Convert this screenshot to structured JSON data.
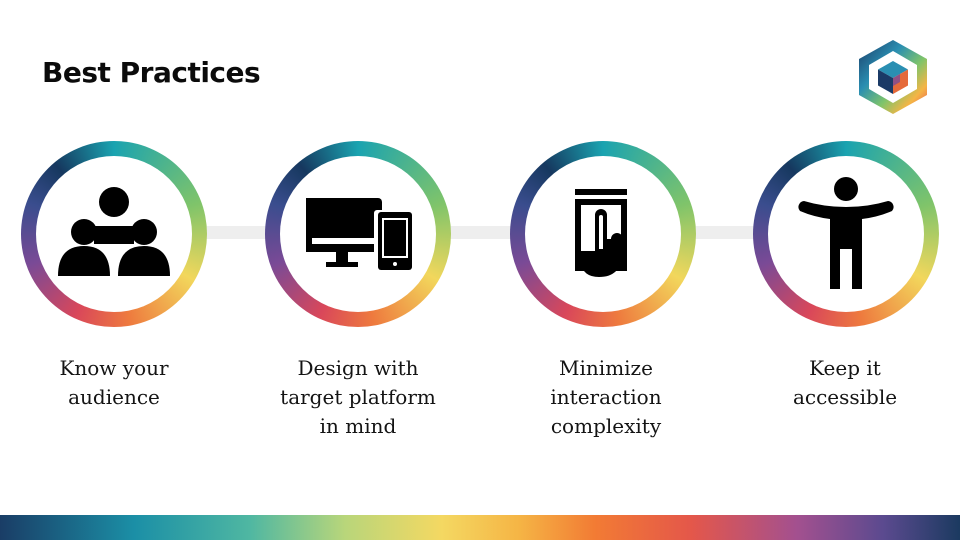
{
  "slide": {
    "title": "Best Practices"
  },
  "items": [
    {
      "lines": [
        "Know your",
        "audience"
      ],
      "icon": "audience-group-icon"
    },
    {
      "lines": [
        "Design with",
        "target platform",
        "in mind"
      ],
      "icon": "devices-icon"
    },
    {
      "lines": [
        "Minimize",
        "interaction",
        "complexity"
      ],
      "icon": "touch-tap-icon"
    },
    {
      "lines": [
        "Keep it",
        "accessible"
      ],
      "icon": "accessibility-person-icon"
    }
  ],
  "colors": {
    "title": "#0b0b0b",
    "icon": "#000000",
    "connector": "#eeeeee",
    "ring_gradient": [
      "#1aa3b0",
      "#7fc46a",
      "#f2d75c",
      "#ee7a3e",
      "#d9475a",
      "#7a4a96",
      "#3a4d8e",
      "#16385f"
    ],
    "logo": [
      "#1b3a66",
      "#2a8fb2",
      "#7a4a96",
      "#e54f5a",
      "#f5b545",
      "#7fc46a"
    ]
  }
}
